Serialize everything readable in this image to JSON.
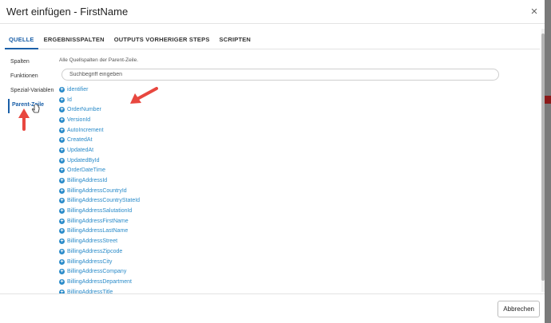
{
  "modal": {
    "title": "Wert einfügen - FirstName",
    "close_label": "×"
  },
  "tabs": [
    {
      "label": "QUELLE",
      "active": true
    },
    {
      "label": "ERGEBNISSPALTEN",
      "active": false
    },
    {
      "label": "OUTPUTS VORHERIGER STEPS",
      "active": false
    },
    {
      "label": "SCRIPTEN",
      "active": false
    }
  ],
  "sidebar": {
    "items": [
      {
        "label": "Spalten",
        "active": false
      },
      {
        "label": "Funktionen",
        "active": false
      },
      {
        "label": "Spezial-Variablen",
        "active": false
      },
      {
        "label": "Parent-Zeile",
        "active": true
      }
    ]
  },
  "content": {
    "description": "Alle Quellspalten der Parent-Zeile.",
    "search_placeholder": "Suchbegriff eingeben",
    "columns": [
      "identifier",
      "Id",
      "OrderNumber",
      "VersionId",
      "AutoIncrement",
      "CreatedAt",
      "UpdatedAt",
      "UpdatedById",
      "OrderDateTime",
      "BillingAddressId",
      "BillingAddressCountryId",
      "BillingAddressCountryStateId",
      "BillingAddressSalutationId",
      "BillingAddressFirstName",
      "BillingAddressLastName",
      "BillingAddressStreet",
      "BillingAddressZipcode",
      "BillingAddressCity",
      "BillingAddressCompany",
      "BillingAddressDepartment",
      "BillingAddressTitle"
    ]
  },
  "footer": {
    "cancel_label": "Abbrechen"
  },
  "colors": {
    "accent": "#1a5fa8",
    "link": "#2a8bc9",
    "annotation": "#e8473f"
  },
  "icons": {
    "column_add": "plus-circle-icon",
    "close": "close-icon"
  }
}
